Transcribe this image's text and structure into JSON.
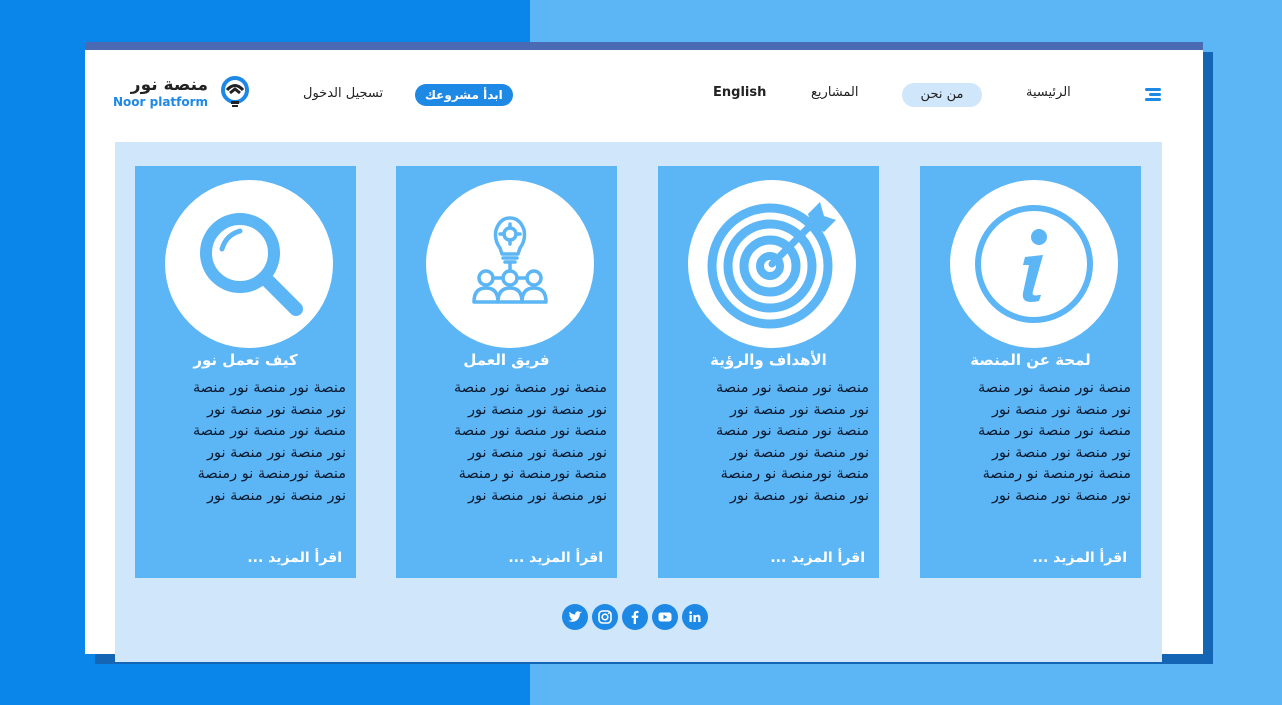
{
  "brand": {
    "name_ar": "منصة نور",
    "name_en": "Noor platform"
  },
  "header": {
    "login_label": "تسجيل الدخول",
    "start_project_label": "ابدأ مشروعك",
    "nav": {
      "english": "English",
      "projects": "المشاريع",
      "about": "من نحن",
      "home": "الرئيسية"
    }
  },
  "cards": [
    {
      "title": "لمحة عن المنصة",
      "icon": "info-icon",
      "lines": [
        "منصة نور منصة نور منصة",
        "نور منصة نور منصة نور",
        "منصة نور منصة نور منصة",
        "نور منصة نور منصة نور",
        "منصة نورمنصة نو رمنصة",
        "نور منصة نور منصة نور"
      ],
      "more": "اقرأ المزيد ..."
    },
    {
      "title": "الأهداف والرؤية",
      "icon": "target-icon",
      "lines": [
        "منصة نور منصة نور منصة",
        "نور منصة نور منصة نور",
        "منصة نور منصة نور منصة",
        "نور منصة نور منصة نور",
        "منصة نورمنصة نو رمنصة",
        "نور منصة نور منصة نور"
      ],
      "more": "اقرأ المزيد ..."
    },
    {
      "title": "فريق العمل",
      "icon": "team-icon",
      "lines": [
        "منصة نور منصة نور منصة",
        "نور منصة نور منصة نور",
        "منصة نور منصة نور منصة",
        "نور منصة نور منصة نور",
        "منصة نورمنصة نو رمنصة",
        "نور منصة نور منصة نور"
      ],
      "more": "اقرأ المزيد ..."
    },
    {
      "title": "كيف تعمل نور",
      "icon": "search-icon",
      "lines": [
        "منصة نور منصة نور منصة",
        "نور منصة نور منصة نور",
        "منصة نور منصة نور منصة",
        "نور منصة نور منصة نور",
        "منصة نورمنصة نو رمنصة",
        "نور منصة نور منصة نور"
      ],
      "more": "اقرأ المزيد ..."
    }
  ],
  "social": [
    "twitter-icon",
    "instagram-icon",
    "facebook-icon",
    "youtube-icon",
    "linkedin-icon"
  ],
  "colors": {
    "accent": "#1e88e5",
    "card": "#5cb5f5",
    "panel": "#cfe6fb",
    "frame_top": "#4a6ab3"
  }
}
